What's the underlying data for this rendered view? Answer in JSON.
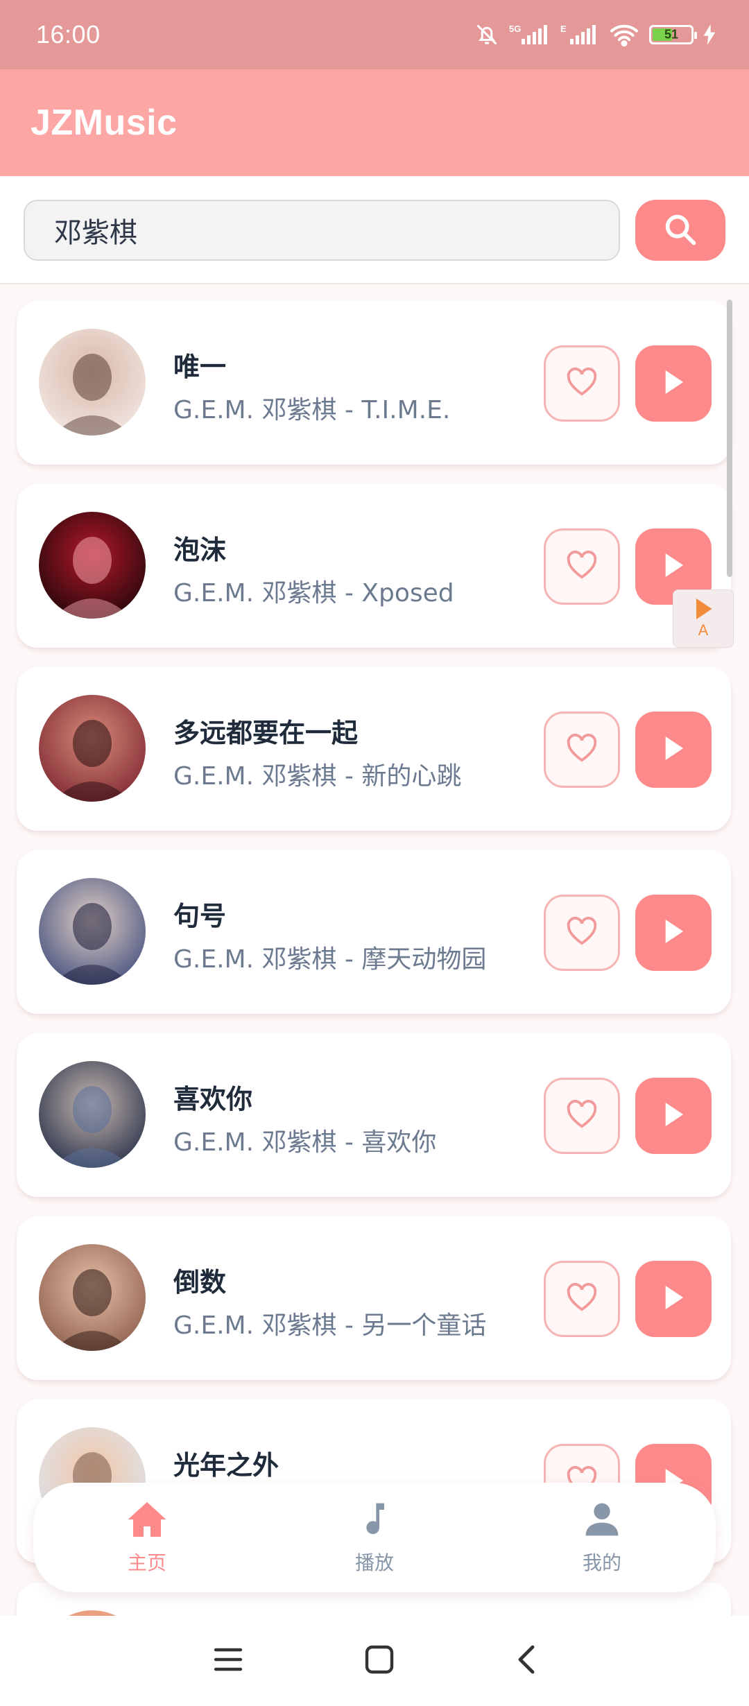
{
  "status_bar": {
    "time": "16:00",
    "network_label": "5G",
    "secondary_network": "E",
    "battery_level": "51",
    "icons": [
      "bell-muted-icon",
      "signal-icon",
      "signal-icon",
      "wifi-icon",
      "battery-icon",
      "charging-icon"
    ]
  },
  "app": {
    "title": "JZMusic",
    "accent_color": "#fd8a8a",
    "header_color": "#fda6a6"
  },
  "search": {
    "value": "邓紫棋",
    "icon": "search-icon"
  },
  "songs": [
    {
      "title": "唯一",
      "subtitle": "G.E.M. 邓紫棋 - T.I.M.E."
    },
    {
      "title": "泡沫",
      "subtitle": "G.E.M. 邓紫棋 - Xposed"
    },
    {
      "title": "多远都要在一起",
      "subtitle": "G.E.M. 邓紫棋 - 新的心跳"
    },
    {
      "title": "句号",
      "subtitle": "G.E.M. 邓紫棋 - 摩天动物园"
    },
    {
      "title": "喜欢你",
      "subtitle": "G.E.M. 邓紫棋 - 喜欢你"
    },
    {
      "title": "倒数",
      "subtitle": "G.E.M. 邓紫棋 - 另一个童话"
    },
    {
      "title": "光年之外",
      "subtitle": ""
    }
  ],
  "floating_widget": {
    "letter": "A"
  },
  "bottom_nav": [
    {
      "label": "主页",
      "icon": "home-icon",
      "active": true
    },
    {
      "label": "播放",
      "icon": "music-note-icon",
      "active": false
    },
    {
      "label": "我的",
      "icon": "user-icon",
      "active": false
    }
  ],
  "system_nav": [
    "menu-icon",
    "home-square-icon",
    "back-icon"
  ]
}
